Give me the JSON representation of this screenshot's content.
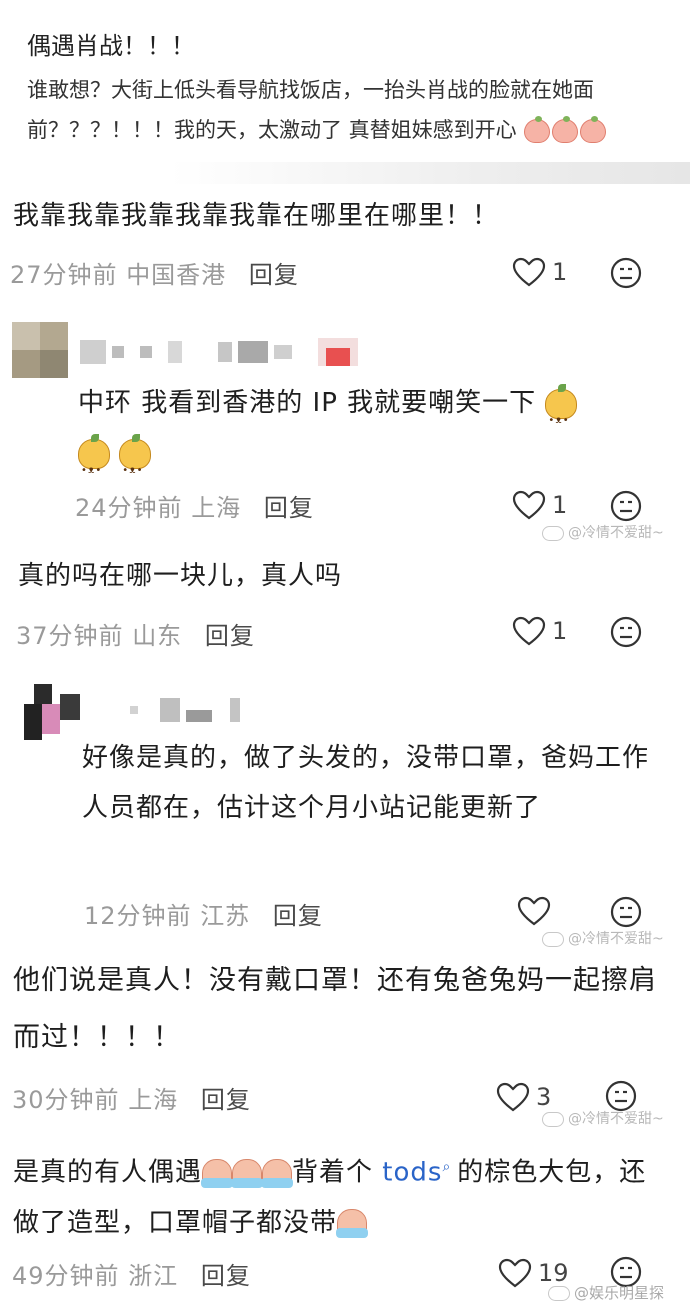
{
  "post": {
    "title": "偶遇肖战！！！",
    "body": "谁敢想？大街上低头看导航找饭店，一抬头肖战的脸就在她面前？？？！！！我的天，太激动了 真替姐妹感到开心"
  },
  "comments": [
    {
      "text": "我靠我靠我靠我靠我靠在哪里在哪里！！",
      "time": "27分钟前",
      "location": "中国香港",
      "reply_label": "回复",
      "likes": "1"
    },
    {
      "text": "中环 我看到香港的 IP 我就要嘲笑一下",
      "time": "24分钟前",
      "location": "上海",
      "reply_label": "回复",
      "likes": "1"
    },
    {
      "text": "真的吗在哪一块儿，真人吗",
      "time": "37分钟前",
      "location": "山东",
      "reply_label": "回复",
      "likes": "1"
    },
    {
      "text": "好像是真的，做了头发的，没带口罩，爸妈工作人员都在，估计这个月小站记能更新了",
      "time": "12分钟前",
      "location": "江苏",
      "reply_label": "回复",
      "likes": ""
    },
    {
      "text": "他们说是真人！没有戴口罩！还有兔爸兔妈一起擦肩而过！！！！",
      "time": "30分钟前",
      "location": "上海",
      "reply_label": "回复",
      "likes": "3"
    },
    {
      "text_before": "是真的有人偶遇",
      "text_tods": "tods",
      "text_after": "的棕色大包，还做了造型，口罩帽子都没带",
      "text_mid": "背着个 ",
      "time": "49分钟前",
      "location": "浙江",
      "reply_label": "回复",
      "likes": "19"
    }
  ],
  "watermarks": [
    "@冷情不爱甜~",
    "@冷情不爱甜~",
    "@冷情不爱甜~",
    "@娱乐明星探"
  ],
  "icons": {
    "like": "heart-outline-icon",
    "dislike": "neutral-face-icon",
    "search": "search-magnifier-icon"
  },
  "colors": {
    "link": "#2a64c8",
    "meta": "#9a9a9a",
    "text": "#1e1e1e"
  }
}
